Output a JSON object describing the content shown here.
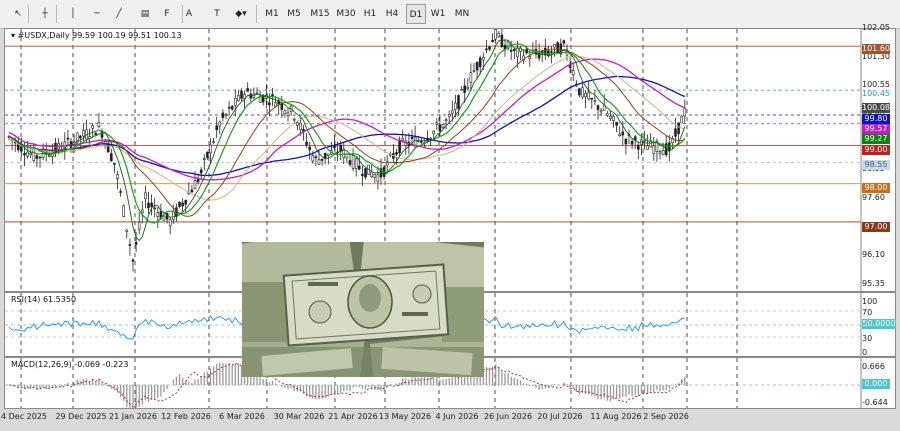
{
  "toolbar": {
    "tools": [
      {
        "name": "cursor-tool",
        "glyph": "↖"
      },
      {
        "name": "crosshair-tool",
        "glyph": "┼"
      },
      {
        "name": "vertical-line-tool",
        "glyph": "│"
      },
      {
        "name": "horizontal-line-tool",
        "glyph": "─"
      },
      {
        "name": "trendline-tool",
        "glyph": "╱"
      },
      {
        "name": "channel-tool",
        "glyph": "▤"
      },
      {
        "name": "fibonacci-tool",
        "glyph": "F"
      },
      {
        "name": "text-tool",
        "glyph": "A"
      },
      {
        "name": "text-label-tool",
        "glyph": "T"
      },
      {
        "name": "shapes-tool",
        "glyph": "◆▾"
      }
    ],
    "timeframes": [
      "M1",
      "M5",
      "M15",
      "M30",
      "H1",
      "H4",
      "D1",
      "W1",
      "MN"
    ],
    "active_timeframe": "D1"
  },
  "main_chart": {
    "symbol_label": "#USDX,Daily",
    "ohlc": "99.59 100.19 99.51 100.13",
    "price_ticks": [
      "102.05",
      "101.30",
      "100.55",
      "99.80",
      "99.10",
      "98.35",
      "97.60",
      "96.85",
      "96.10",
      "95.35"
    ],
    "price_tags": [
      {
        "text": "101.60",
        "bg": "#a0522d",
        "fg": "#ffffff"
      },
      {
        "text": "100.45",
        "bg": "#ffffff",
        "fg": "#20a0a0"
      },
      {
        "text": "100.08",
        "bg": "#4a4a4a",
        "fg": "#ffffff"
      },
      {
        "text": "99.80",
        "bg": "#1010c0",
        "fg": "#ffffff"
      },
      {
        "text": "99.57",
        "bg": "#c020c0",
        "fg": "#ffffff"
      },
      {
        "text": "99.27",
        "bg": "#108010",
        "fg": "#ffffff"
      },
      {
        "text": "99.00",
        "bg": "#c02020",
        "fg": "#ffffff"
      },
      {
        "text": "98.55",
        "bg": "#c8d8e8",
        "fg": "#406080"
      },
      {
        "text": "98.00",
        "bg": "#c87020",
        "fg": "#ffffff"
      },
      {
        "text": "97.00",
        "bg": "#8b3a1a",
        "fg": "#ffffff"
      }
    ]
  },
  "rsi": {
    "label": "RSI(14) 61.5350",
    "ticks": [
      "100",
      "70",
      "30",
      "0"
    ],
    "tag": "50.0000"
  },
  "macd": {
    "label": "MACD(12,26,9) -0.069 -0.223",
    "ticks": [
      "0.666",
      "-0.644"
    ],
    "tag": "0.000"
  },
  "date_labels": [
    "4 Dec 2025",
    "29 Dec 2025",
    "21 Jan 2026",
    "12 Feb 2026",
    "6 Mar 2026",
    "30 Mar 2026",
    "21 Apr 2026",
    "13 May 2026",
    "4 Jun 2026",
    "26 Jun 2026",
    "20 Jul 2026",
    "11 Aug 2026",
    "2 Sep 2026"
  ],
  "colors": {
    "candle": "#222222",
    "ma_fast": "#1aa01a",
    "ma_medium": "#8b4513",
    "ma_slow": "#1010c0",
    "ma_magenta": "#c020c0",
    "ma_tan": "#d2b48c",
    "rsi_line": "#1e90ff",
    "macd_hist": "#9a9a9a",
    "macd_signal": "#c02020"
  }
}
